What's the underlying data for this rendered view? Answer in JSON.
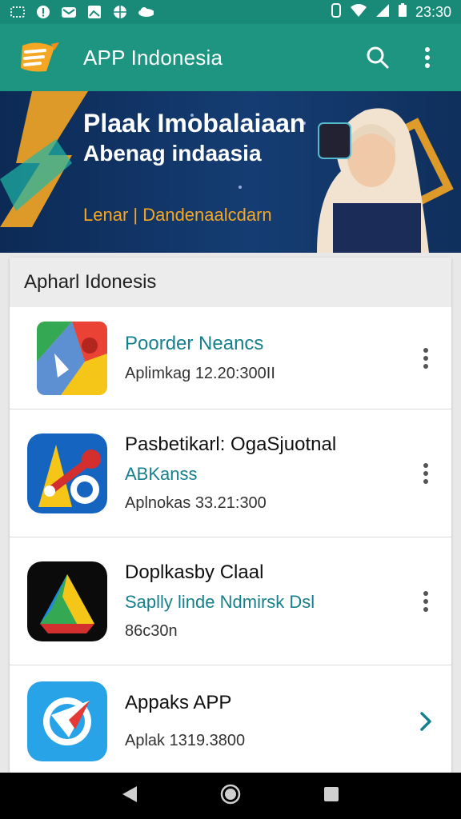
{
  "status_bar": {
    "time": "23:30",
    "left_icons": [
      "notification-icon",
      "info-icon",
      "mail-icon",
      "image-icon",
      "globe-icon",
      "cloud-icon"
    ],
    "right_icons": [
      "vibrate-icon",
      "wifi-icon",
      "signal-icon",
      "battery-icon"
    ]
  },
  "app_bar": {
    "title": "APP Indonesia",
    "icons": [
      "app-logo-icon",
      "search-icon",
      "more-vert-icon"
    ]
  },
  "banner": {
    "line1": "Plaak Imobalaiaan",
    "line2": "Abenag indaasia",
    "line3": "Lenar | Dandenaalcdarn"
  },
  "section": {
    "title": "Apharl Idonesis"
  },
  "apps": [
    {
      "name": "Poorder Neancs",
      "subtitle": "",
      "meta": "Aplimkag 12.20:300II",
      "icon": "maps-icon",
      "action": "more-vert-icon"
    },
    {
      "name": "Pasbetikarl: OgaSjuotnal",
      "subtitle": "ABKanss",
      "meta": "Aplnokas 33.21:300",
      "icon": "scooter-icon",
      "action": "more-vert-icon"
    },
    {
      "name": "Doplkasby Claal",
      "subtitle": "Saplly linde Ndmirsk Dsl",
      "meta": "86c30n",
      "icon": "drive-icon",
      "action": "more-vert-icon"
    },
    {
      "name": "Appaks APP",
      "subtitle": "",
      "meta": "Aplak 1319.3800",
      "icon": "compass-icon",
      "action": "chevron-right-icon"
    }
  ],
  "colors": {
    "app_bar": "#1e9580",
    "accent": "#16808c"
  }
}
